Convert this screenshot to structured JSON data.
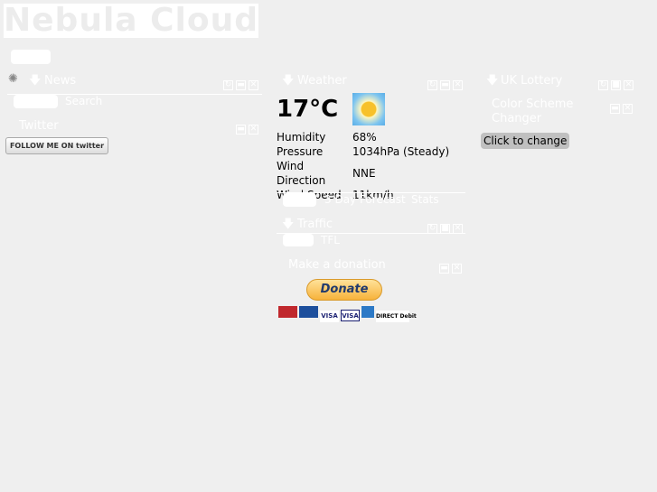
{
  "logo": {
    "text": "Nebula Cloud"
  },
  "news": {
    "title": "News",
    "tabs": [
      "Search"
    ]
  },
  "twitter": {
    "title": "Twitter",
    "button": "FOLLOW ME ON twitter"
  },
  "weather": {
    "title": "Weather",
    "temp": "17°C",
    "icon": "sun-icon",
    "rows": [
      {
        "label": "Humidity",
        "value": "68%"
      },
      {
        "label": "Pressure",
        "value": "1034hPa (Steady)"
      },
      {
        "label": "Wind Direction",
        "value": "NNE"
      },
      {
        "label": "Wind Speed",
        "value": "11km/h"
      }
    ],
    "tabs": [
      "3 Day Forecast",
      "Stats"
    ]
  },
  "traffic": {
    "title": "Traffic",
    "tabs": [
      "TFL"
    ]
  },
  "donation": {
    "title": "Make a donation",
    "button": "Donate",
    "cards": [
      "MasterCard",
      "Maestro",
      "VISA",
      "VISA",
      "AMEX",
      "DIRECT Debit"
    ]
  },
  "lottery": {
    "title": "UK Lottery"
  },
  "colors": {
    "title": "Color Scheme Changer",
    "button": "Click to change"
  }
}
